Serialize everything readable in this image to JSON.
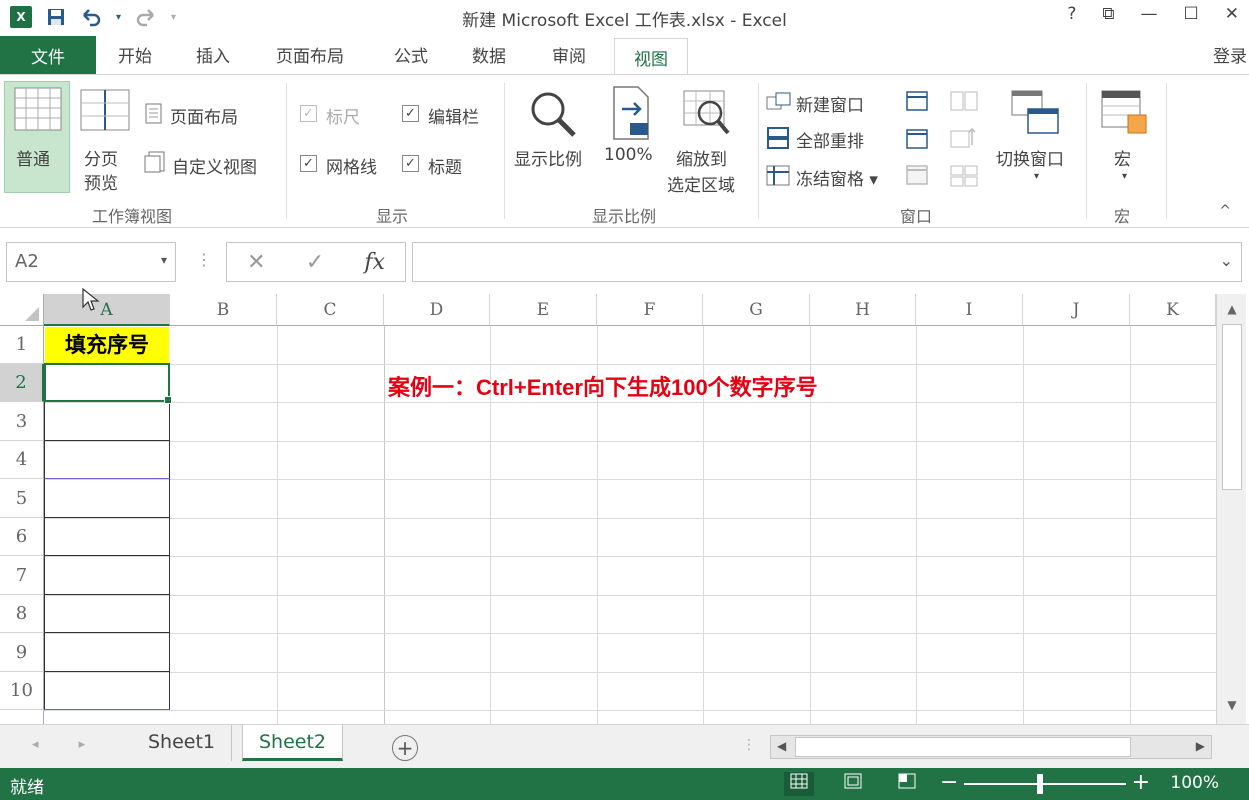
{
  "window": {
    "title": "新建 Microsoft Excel 工作表.xlsx - Excel",
    "help": "?",
    "controls": [
      "⧉",
      "—",
      "☐",
      "✕"
    ]
  },
  "qat": {
    "logo": "X",
    "save_icon": "save-icon",
    "undo_icon": "undo-icon",
    "redo_icon": "redo-icon"
  },
  "tabs": {
    "file": "文件",
    "items": [
      "开始",
      "插入",
      "页面布局",
      "公式",
      "数据",
      "审阅"
    ],
    "active": "视图",
    "login": "登录"
  },
  "ribbon": {
    "workbook_views": {
      "label": "工作簿视图",
      "normal": "普通",
      "page_break_1": "分页",
      "page_break_2": "预览",
      "page_layout": "页面布局",
      "custom_views": "自定义视图"
    },
    "show": {
      "label": "显示",
      "ruler": "标尺",
      "formula_bar": "编辑栏",
      "gridlines": "网格线",
      "headings": "标题",
      "check": "✓"
    },
    "zoom": {
      "label": "显示比例",
      "zoom": "显示比例",
      "hundred": "100%",
      "zoom_sel_1": "缩放到",
      "zoom_sel_2": "选定区域"
    },
    "window": {
      "label": "窗口",
      "new_window": "新建窗口",
      "arrange_all": "全部重排",
      "freeze_panes": "冻结窗格 ▾",
      "switch_windows": "切换窗口",
      "switch_caret": "▾"
    },
    "macros": {
      "label": "宏",
      "macros": "宏",
      "caret": "▾"
    },
    "collapse": "^"
  },
  "formula_bar": {
    "name_box": "A2",
    "cancel": "✕",
    "enter": "✓",
    "fx": "fx",
    "dots": "⋮",
    "caret": "▾",
    "expand": "⌄"
  },
  "grid": {
    "columns": [
      "A",
      "B",
      "C",
      "D",
      "E",
      "F",
      "G",
      "H",
      "I",
      "J",
      "K"
    ],
    "rows": [
      "1",
      "2",
      "3",
      "4",
      "5",
      "6",
      "7",
      "8",
      "9",
      "10"
    ],
    "a1": "填充序号",
    "note": "案例一：Ctrl+Enter向下生成100个数字序号"
  },
  "sheets": {
    "tabs": [
      "Sheet1",
      "Sheet2"
    ],
    "active": "Sheet2",
    "add": "+",
    "nav": "◂ ▸"
  },
  "status": {
    "ready": "就绪",
    "zoom": "100%",
    "minus": "−",
    "plus": "+"
  }
}
